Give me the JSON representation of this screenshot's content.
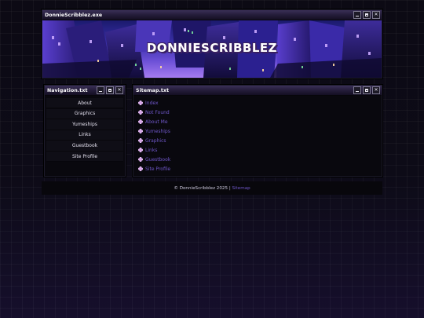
{
  "banner_window": {
    "title": "DonnieScribblez.exe",
    "banner_text": "DONNIESCRIBBLEZ"
  },
  "controls": {
    "minimize": "minimize",
    "maximize": "maximize",
    "close": "✕"
  },
  "nav_window": {
    "title": "Navigation.txt",
    "items": [
      "About",
      "Graphics",
      "Yumeships",
      "Links",
      "Guestbook",
      "Site Profile"
    ]
  },
  "sitemap_window": {
    "title": "Sitemap.txt",
    "items": [
      "Index",
      "Not Found",
      "About Me",
      "Yumeships",
      "Graphics",
      "Links",
      "Guestbook",
      "Site Profile"
    ],
    "link_color": "#6f57c9"
  },
  "footer": {
    "copyright": "© DonnieScribblez 2025 |",
    "link": "Sitemap"
  }
}
